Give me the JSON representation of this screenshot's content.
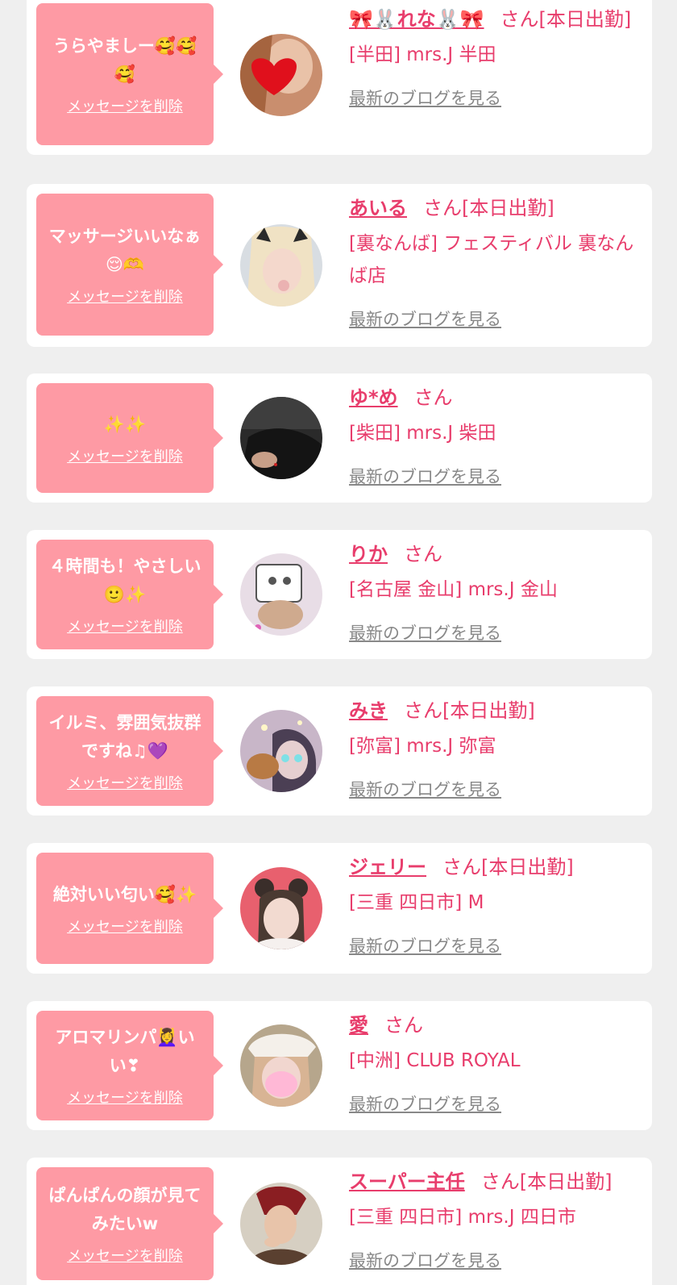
{
  "colors": {
    "background": "#efefef",
    "card": "#ffffff",
    "bubble": "#fe9aa4",
    "accent_pink": "#e83d6c",
    "link_gray": "#888888"
  },
  "delete_label": "メッセージを削除",
  "blog_label": "最新のブログを見る",
  "entries": [
    {
      "message": "うらやましー🥰🥰🥰",
      "name": "🎀🐰れな🐰🎀",
      "suffix": "さん[本日出勤]",
      "shop": "[半田] mrs.J 半田"
    },
    {
      "message": "マッサージいいなぁ😌🫶",
      "name": "あいる",
      "suffix": "さん[本日出勤]",
      "shop": "[裏なんば] フェスティバル 裏なんば店"
    },
    {
      "message": "✨✨",
      "name": "ゆ*め",
      "suffix": "さん",
      "shop": "[柴田] mrs.J 柴田"
    },
    {
      "message": "４時間も！やさしい🙂✨",
      "name": "りか",
      "suffix": "さん",
      "shop": "[名古屋 金山] mrs.J 金山"
    },
    {
      "message": "イルミ、雰囲気抜群ですね♫💜",
      "name": "みき",
      "suffix": "さん[本日出勤]",
      "shop": "[弥富] mrs.J 弥富"
    },
    {
      "message": "絶対いい匂い🥰✨",
      "name": "ジェリー",
      "suffix": "さん[本日出勤]",
      "shop": "[三重 四日市] M"
    },
    {
      "message": "アロマリンパ💆‍♀️いい❣",
      "name": "愛",
      "suffix": "さん",
      "shop": "[中洲] CLUB ROYAL"
    },
    {
      "message": "ぱんぱんの顔が見てみたいw",
      "name": "スーパー主任",
      "suffix": "さん[本日出勤]",
      "shop": "[三重 四日市] mrs.J 四日市"
    }
  ]
}
